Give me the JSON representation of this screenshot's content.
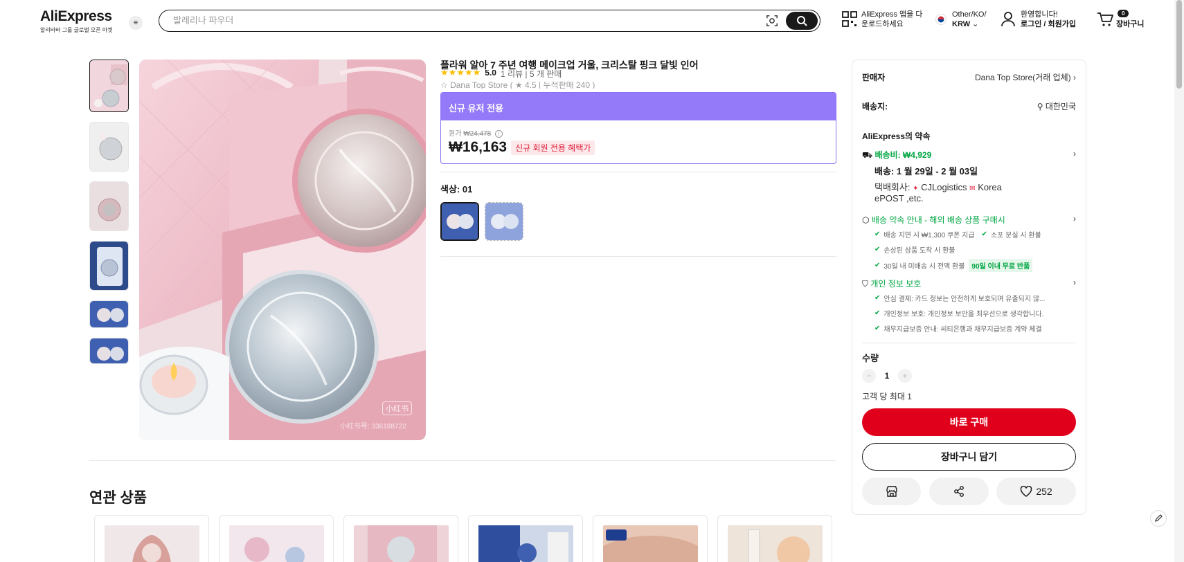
{
  "header": {
    "logo": "AliExpress",
    "logo_sub": "알리바바 그룹 글로벌 오픈 마켓",
    "search_placeholder": "발레리나 파우더",
    "app_line1": "AliExpress 앱을 다",
    "app_line2": "운로드하세요",
    "region_line1": "Other/KO/",
    "region_line2": "KRW",
    "account_line1": "환영합니다!",
    "account_line2": "로그인 / 회원가입",
    "cart_count": "0",
    "cart_label": "장바구니"
  },
  "product": {
    "title": "플라워 알아 7 주년 여행 메이크업 거울, 크리스탈 핑크 달빛 인어",
    "stars": "★★★★★",
    "score": "5.0",
    "rating_meta": "1 리뷰 | 5 개 판매",
    "store_line": "☆ Dana Top Store ( ★ 4.5 | 누적판매 240 )",
    "image_tag": "小红书",
    "image_watermark": "小红书号: 336188722"
  },
  "promo": {
    "header": "신규 유저 전용",
    "orig_label": "원가",
    "orig_price": "₩24,478",
    "price": "₩16,163",
    "badge": "신규 회원 전용 혜택가"
  },
  "color": {
    "label": "색상: 01"
  },
  "related": {
    "title": "연관 상품"
  },
  "panel": {
    "seller_label": "판매자",
    "seller_name": "Dana Top Store(거래 업체)",
    "ship_to_label": "배송지:",
    "ship_to": "대한민국",
    "promise_title": "AliExpress의 약속",
    "shipping_fee": "배송비: ₩4,929",
    "delivery_date": "배송: 1 월 29일 - 2 월 03일",
    "carrier_label": "택배회사:",
    "carrier_1": "CJLogistics",
    "carrier_2": "Korea",
    "carrier_3": "ePOST ,etc.",
    "guarantee_title": "배송 약속 안내 - 해외 배송 상품 구매시",
    "guarantee_items": [
      "배송 지연 시 ₩1,300 쿠폰 지급",
      "소포 분실 시 환불",
      "손상된 상품 도착 시 환불",
      "30일 내 미배송 시 전액 환불"
    ],
    "return_badge": "90일 이내 무료 반품",
    "privacy_title": "개인 정보 보호",
    "privacy_items": [
      "안심 결제: 카드 정보는 안전하게 보호되며 유출되지 않...",
      "개인정보 보호: 개인정보 보안을 최우선으로 생각합니다.",
      "채무지급보증 안내: 씨티은행과 채무지급보증 계약 체결"
    ],
    "qty_label": "수량",
    "qty_value": "1",
    "qty_limit": "고객 당 최대 1",
    "buy_now": "바로 구매",
    "add_to_cart": "장바구니 담기",
    "wishlist_count": "252"
  },
  "colors": {
    "accent_red": "#e0001b",
    "promo_purple": "#9479f8",
    "guarantee_green": "#00a642",
    "star_yellow": "#fdbd00"
  }
}
